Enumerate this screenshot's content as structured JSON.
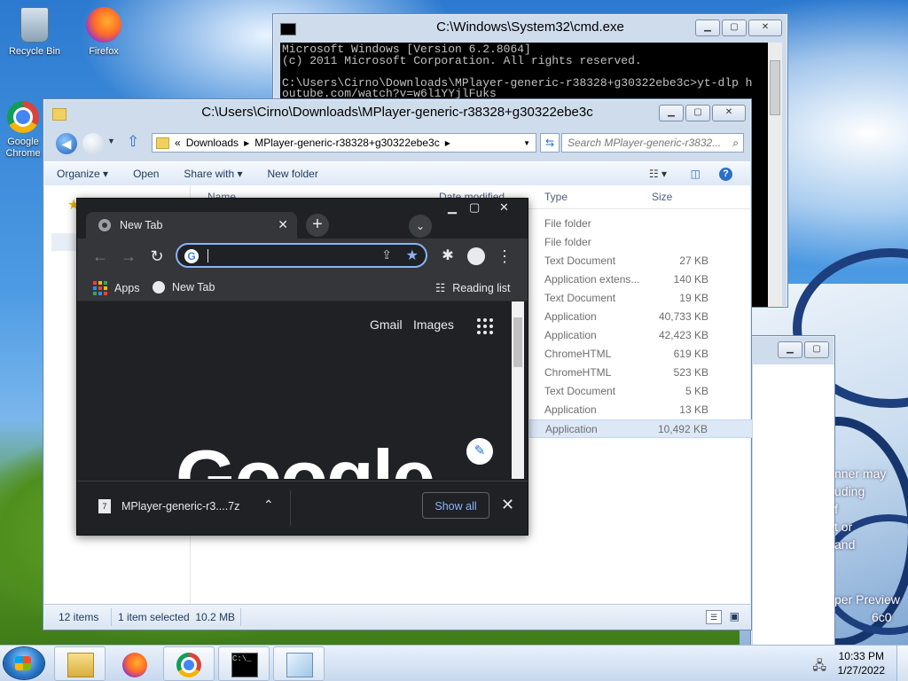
{
  "desktop": {
    "icons": [
      {
        "label": "Recycle Bin"
      },
      {
        "label": "Firefox"
      },
      {
        "label": "Google Chrome"
      }
    ]
  },
  "cmd": {
    "title": "C:\\Windows\\System32\\cmd.exe",
    "lines": [
      "Microsoft Windows [Version 6.2.8064]",
      "(c) 2011 Microsoft Corporation. All rights reserved.",
      "",
      "C:\\Users\\Cirno\\Downloads\\MPlayer-generic-r38328+g30322ebe3c>yt-dlp h",
      "outube.com/watch?v=w6l1YYjlFuks"
    ]
  },
  "explorer": {
    "title": "C:\\Users\\Cirno\\Downloads\\MPlayer-generic-r38328+g30322ebe3c",
    "breadcrumb": [
      "«",
      "Downloads",
      "MPlayer-generic-r38328+g30322ebe3c"
    ],
    "search_placeholder": "Search MPlayer-generic-r3832...",
    "toolbar": {
      "organize": "Organize",
      "open": "Open",
      "share_with": "Share with",
      "new_folder": "New folder"
    },
    "columns": {
      "name": "Name",
      "date": "Date modified",
      "type": "Type",
      "size": "Size"
    },
    "rows": [
      {
        "type": "File folder",
        "size": ""
      },
      {
        "type": "File folder",
        "size": ""
      },
      {
        "type": "Text Document",
        "size": "27 KB"
      },
      {
        "type": "Application extens...",
        "size": "140 KB"
      },
      {
        "type": "Text Document",
        "size": "19 KB"
      },
      {
        "type": "Application",
        "size": "40,733 KB"
      },
      {
        "type": "Application",
        "size": "42,423 KB"
      },
      {
        "type": "ChromeHTML",
        "size": "619 KB"
      },
      {
        "type": "ChromeHTML",
        "size": "523 KB"
      },
      {
        "type": "Text Document",
        "size": "5 KB"
      },
      {
        "type": "Application",
        "size": "13 KB"
      },
      {
        "type": "Application",
        "size": "10,492 KB",
        "selected": true
      }
    ],
    "status": {
      "count": "12 items",
      "selection": "1 item selected  10.2 MB"
    }
  },
  "chrome": {
    "tab_title": "New Tab",
    "bookmarks": {
      "apps": "Apps",
      "newtab": "New Tab",
      "reading_list": "Reading list"
    },
    "page": {
      "gmail": "Gmail",
      "images": "Images",
      "logo": "Google"
    },
    "download": {
      "filename": "MPlayer-generic-r3....7z",
      "show_all": "Show all"
    }
  },
  "taskbar": {
    "time": "10:33 PM",
    "date": "1/27/2022"
  },
  "behind_text": [
    "nner may",
    "uding",
    "f",
    "t or",
    "and",
    "per Preview",
    "6c0"
  ]
}
